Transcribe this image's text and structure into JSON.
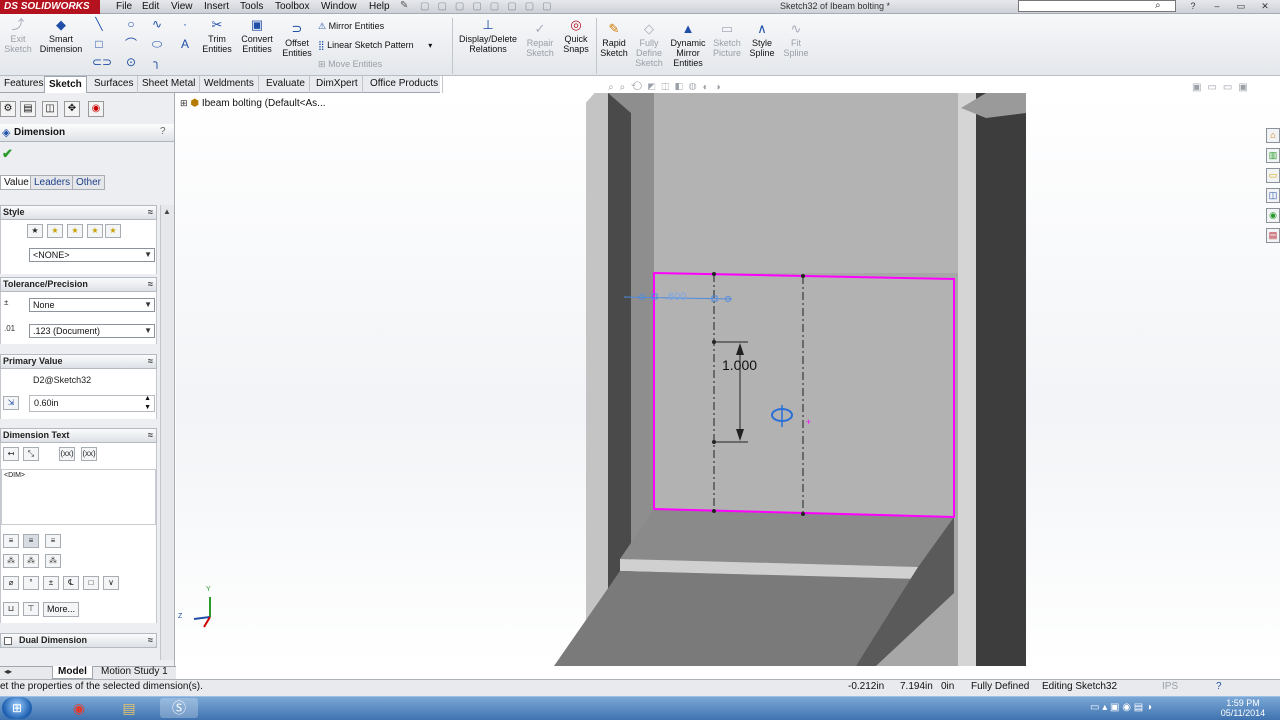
{
  "window": {
    "logo": "SOLIDWORKS",
    "logo_prefix": "DS",
    "document_title": "Sketch32 of Ibeam bolting *",
    "menu": [
      "File",
      "Edit",
      "View",
      "Insert",
      "Tools",
      "Toolbox",
      "Window",
      "Help"
    ]
  },
  "commands": {
    "exit_sketch": "Exit Sketch",
    "smart_dimension": "Smart Dimension",
    "trim_entities": "Trim Entities",
    "convert_entities": "Convert Entities",
    "offset_entities": "Offset Entities",
    "mirror_entities": "Mirror Entities",
    "linear_sketch_pattern": "Linear Sketch Pattern",
    "move_entities": "Move Entities",
    "display_delete_relations": "Display/Delete Relations",
    "repair_sketch": "Repair Sketch",
    "quick_snaps": "Quick Snaps",
    "rapid_sketch": "Rapid Sketch",
    "fully_define_sketch": "Fully Define Sketch",
    "dynamic_mirror_entities": "Dynamic Mirror Entities",
    "sketch_picture": "Sketch Picture",
    "style_spline": "Style Spline",
    "fit_spline": "Fit Spline"
  },
  "tabs": [
    "Features",
    "Sketch",
    "Surfaces",
    "Sheet Metal",
    "Weldments",
    "Evaluate",
    "DimXpert",
    "Office Products"
  ],
  "active_tab": "Sketch",
  "property_manager": {
    "title": "Dimension",
    "help": "?",
    "subtabs": [
      "Value",
      "Leaders",
      "Other"
    ],
    "style": {
      "header": "Style",
      "favorite": "<NONE>"
    },
    "tolerance": {
      "header": "Tolerance/Precision",
      "type": "None",
      "precision": ".123 (Document)"
    },
    "primary_value": {
      "header": "Primary Value",
      "name": "D2@Sketch32",
      "value": "0.60in"
    },
    "dimension_text": {
      "header": "Dimension Text",
      "text": "<DIM>",
      "more": "More..."
    },
    "dual_dimension": {
      "header": "Dual Dimension"
    }
  },
  "tree": {
    "root": "Ibeam bolting  (Default<As..."
  },
  "graphics": {
    "dimension_vertical": "1.000",
    "dimension_horizontal": ".600",
    "triad_y": "Y",
    "triad_z": "Z"
  },
  "bottom_tabs": [
    "Model",
    "Motion Study 1"
  ],
  "status": {
    "message": "et the properties of the selected dimension(s).",
    "x": "-0.212in",
    "y": "7.194in",
    "z": "0in",
    "state": "Fully Defined",
    "mode": "Editing Sketch32",
    "units": "IPS"
  },
  "taskbar": {
    "time": "1:59 PM",
    "date": "05/11/2014"
  },
  "colors": {
    "sketch_edge": "#ff00ff",
    "selection_blue": "#4f8be0",
    "brand_red": "#b4121f"
  }
}
